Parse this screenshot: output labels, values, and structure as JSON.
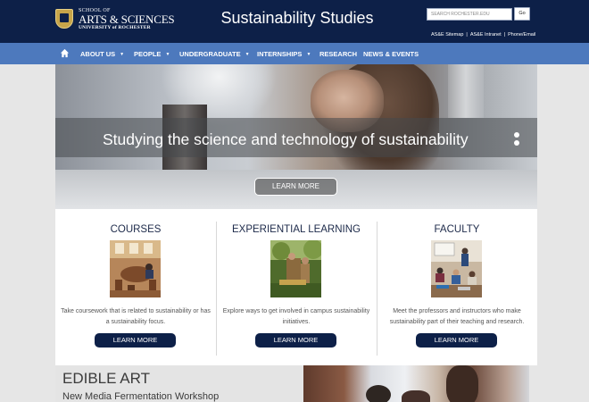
{
  "header": {
    "logo_line1": "SCHOOL OF",
    "logo_line2": "ARTS & SCIENCES",
    "logo_line3": "UNIVERSITY of ROCHESTER",
    "site_title": "Sustainability Studies",
    "search_placeholder": "SEARCH ROCHESTER.EDU",
    "go_label": "Go",
    "utility_links": [
      "AS&E Sitemap",
      "AS&E Intranet",
      "Phone/Email"
    ],
    "separator": "|"
  },
  "nav": {
    "items": [
      {
        "label": "ABOUT US",
        "caret": "▼"
      },
      {
        "label": "PEOPLE",
        "caret": "▼"
      },
      {
        "label": "UNDERGRADUATE",
        "caret": "▼"
      },
      {
        "label": "INTERNSHIPS",
        "caret": "▼"
      },
      {
        "label": "RESEARCH",
        "caret": ""
      },
      {
        "label": "NEWS & EVENTS",
        "caret": ""
      }
    ]
  },
  "hero": {
    "caption": "Studying the science and technology of sustainability",
    "button_label": "LEARN MORE"
  },
  "cards": [
    {
      "title": "COURSES",
      "text": "Take coursework that is related to sustainability or has a sustainability focus.",
      "button_label": "LEARN MORE"
    },
    {
      "title": "EXPERIENTIAL LEARNING",
      "text": "Explore ways to get involved in campus sustainability initiatives.",
      "button_label": "LEARN MORE"
    },
    {
      "title": "FACULTY",
      "text": "Meet the professors and instructors who make sustainability part of their teaching and research.",
      "button_label": "LEARN MORE"
    }
  ],
  "feature": {
    "title": "EDIBLE ART",
    "subtitle": "New Media Fermentation Workshop"
  },
  "colors": {
    "header_bg": "#0d2048",
    "nav_bg": "#4d79bd",
    "button_bg": "#0d2048",
    "seal_gold": "#c7a54a"
  },
  "icons": {
    "home": "home-icon",
    "caret": "chevron-down-icon",
    "logo": "university-seal-icon"
  }
}
